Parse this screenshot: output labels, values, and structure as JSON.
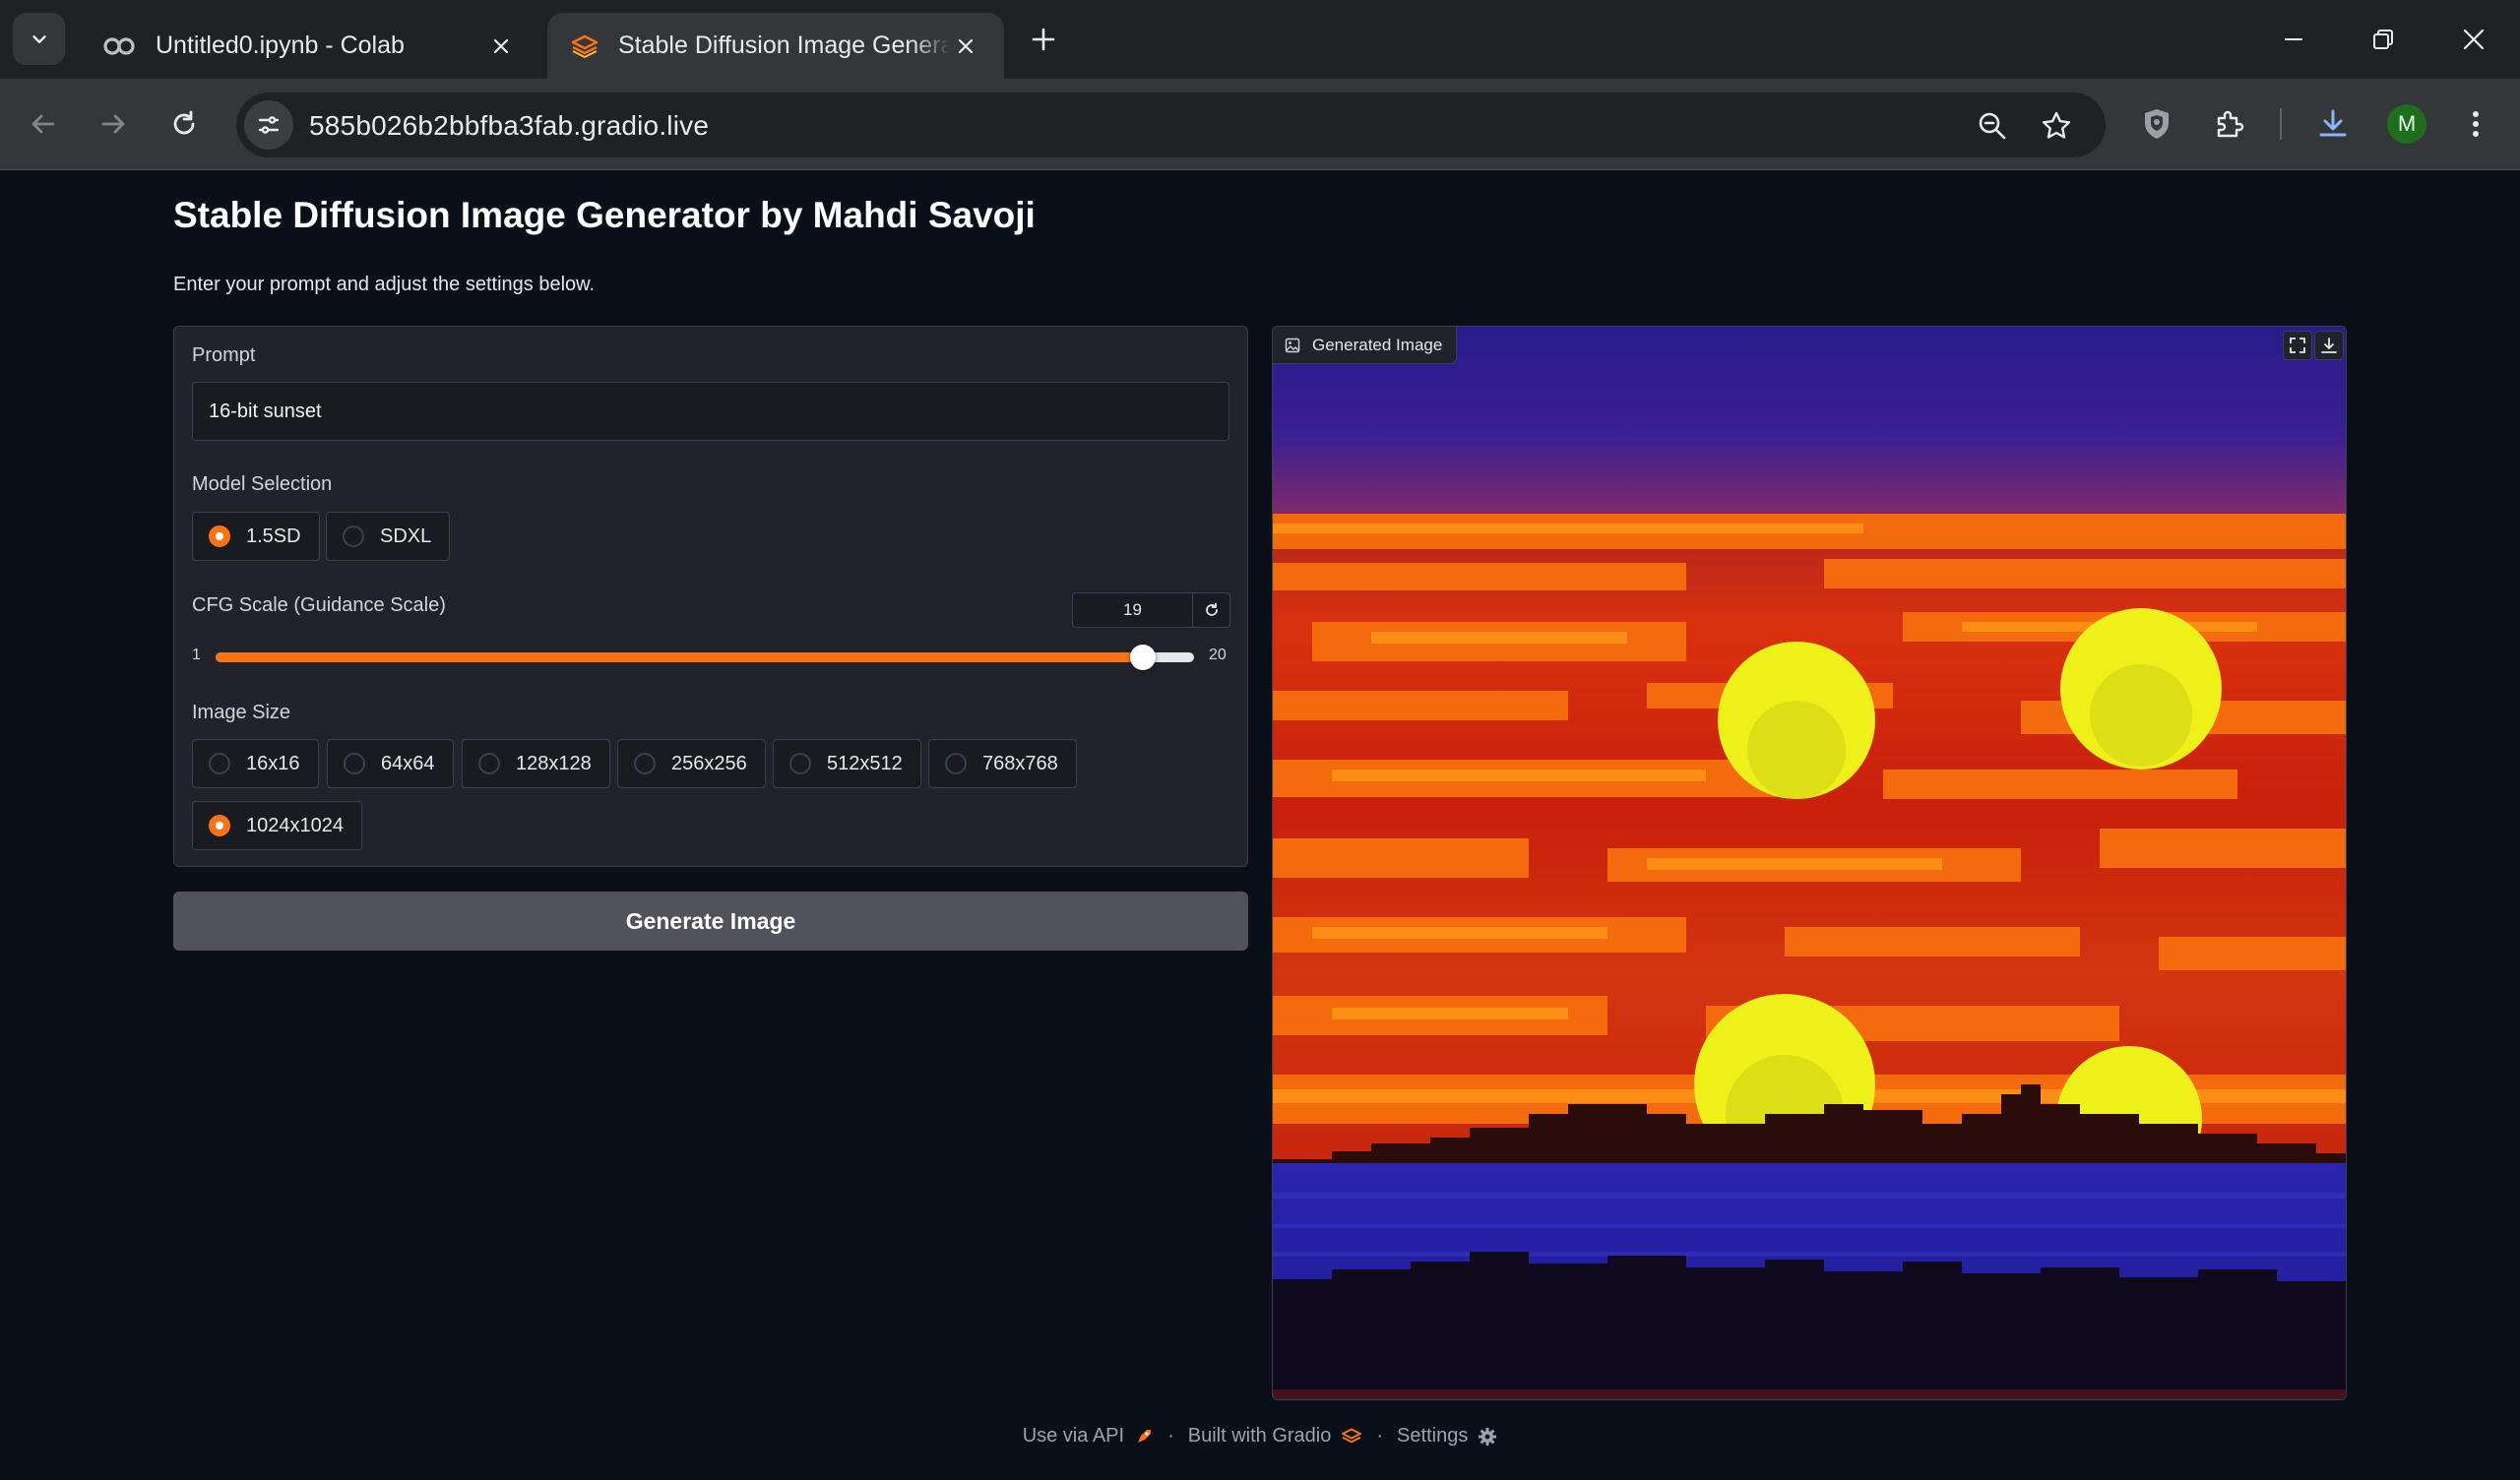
{
  "browser": {
    "tabs": [
      {
        "title": "Untitled0.ipynb - Colab",
        "icon": "colab-icon",
        "active": false
      },
      {
        "title": "Stable Diffusion Image Generator by Mahdi Savoji",
        "icon": "gradio-icon",
        "active": true
      }
    ],
    "url": "585b026b2bbfba3fab.gradio.live",
    "profile_initial": "M"
  },
  "app": {
    "title": "Stable Diffusion Image Generator by Mahdi Savoji",
    "description": "Enter your prompt and adjust the settings below."
  },
  "form": {
    "prompt": {
      "label": "Prompt",
      "value": "16-bit sunset"
    },
    "model": {
      "label": "Model Selection",
      "options": [
        {
          "label": "1.5SD",
          "selected": true
        },
        {
          "label": "SDXL",
          "selected": false
        }
      ]
    },
    "cfg": {
      "label": "CFG Scale (Guidance Scale)",
      "value": "19",
      "min": "1",
      "max": "20",
      "value_num": 19,
      "min_num": 1,
      "max_num": 20
    },
    "image_size": {
      "label": "Image Size",
      "options": [
        {
          "label": "16x16",
          "selected": false
        },
        {
          "label": "64x64",
          "selected": false
        },
        {
          "label": "128x128",
          "selected": false
        },
        {
          "label": "256x256",
          "selected": false
        },
        {
          "label": "512x512",
          "selected": false
        },
        {
          "label": "768x768",
          "selected": false
        },
        {
          "label": "1024x1024",
          "selected": true
        }
      ]
    },
    "generate_label": "Generate Image"
  },
  "output": {
    "label": "Generated Image"
  },
  "footer": {
    "api": "Use via API",
    "built": "Built with Gradio",
    "settings": "Settings"
  },
  "colors": {
    "accent": "#f97316",
    "button": "#52525b",
    "background": "#0b0f19"
  }
}
